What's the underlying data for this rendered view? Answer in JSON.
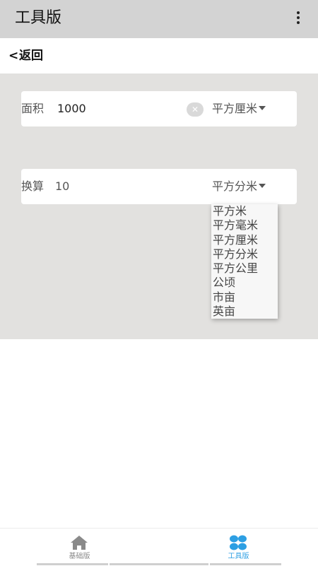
{
  "app_bar": {
    "title": "工具版",
    "menu_icon": "more-vertical-icon"
  },
  "back": {
    "chevron": "<",
    "label": "返回"
  },
  "area_field": {
    "label": "面积",
    "value": "1000",
    "clear_icon": "✕",
    "unit": "平方厘米"
  },
  "convert_field": {
    "label": "换算",
    "value": "10",
    "unit": "平方分米"
  },
  "unit_dropdown": {
    "options": [
      "平方米",
      "平方毫米",
      "平方厘米",
      "平方分米",
      "平方公里",
      "公顷",
      "市亩",
      "英亩"
    ]
  },
  "bottom_nav": {
    "tabs": [
      {
        "label": "基础版",
        "icon": "home-icon",
        "color": "#888888"
      },
      {
        "label": "工具版",
        "icon": "grid-icon",
        "color": "#2d9fe3",
        "active": true
      }
    ]
  },
  "colors": {
    "app_bar_bg": "#d3d3d3",
    "content_bg": "#e2e1df",
    "accent": "#2d9fe3"
  }
}
